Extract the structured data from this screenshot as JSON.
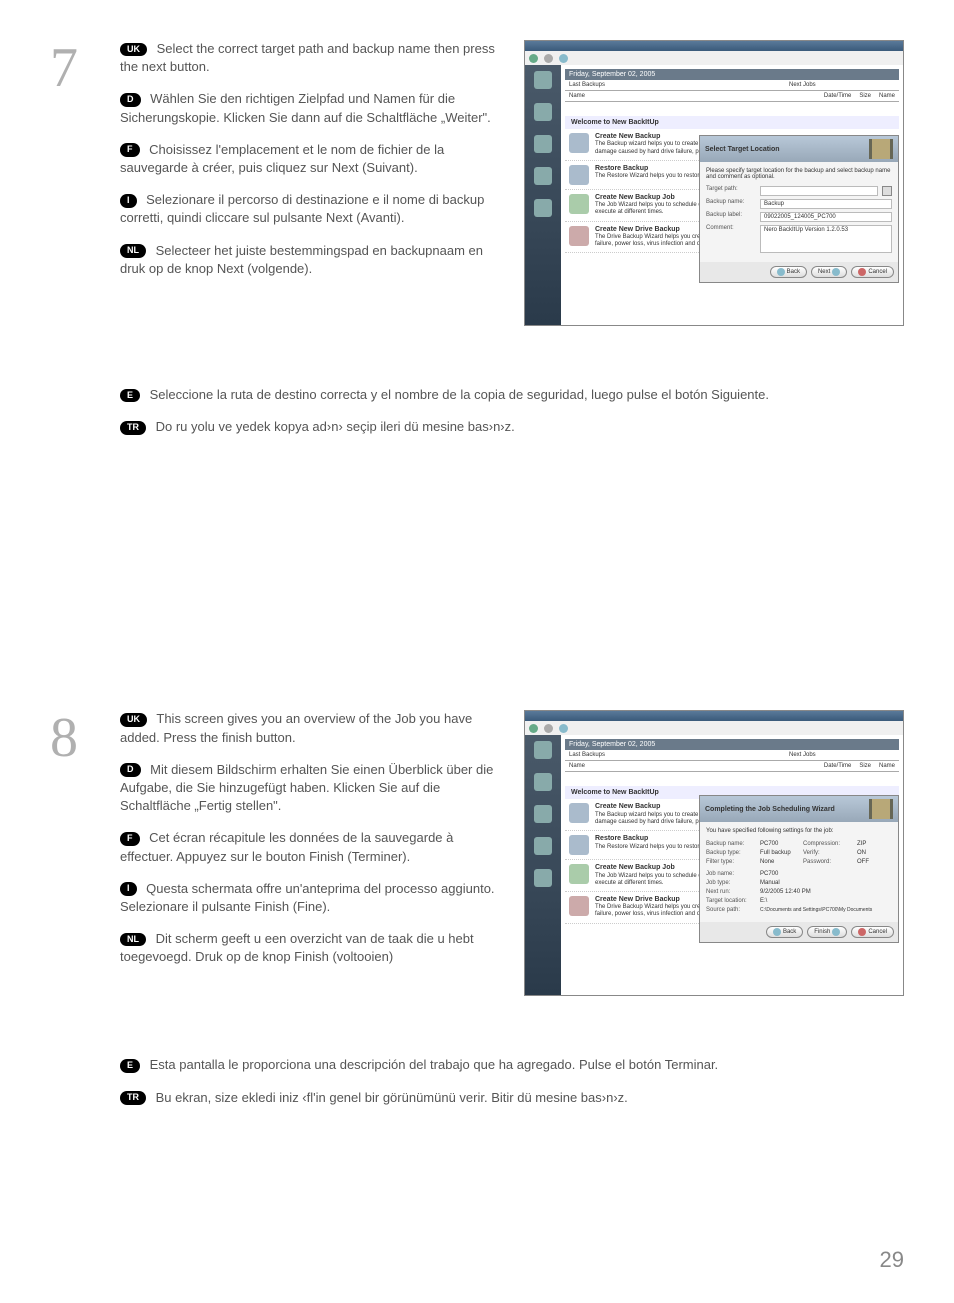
{
  "step7": {
    "number": "7",
    "uk": "Select the correct target path and backup name then press the next button.",
    "d": "Wählen Sie den richtigen Zielpfad und Namen für die Sicherungskopie. Klicken Sie dann auf die Schaltfläche „Weiter\".",
    "f": "Choisissez l'emplacement et le nom de fichier de la sauvegarde à créer, puis cliquez sur Next (Suivant).",
    "i": "Selezionare il percorso di destinazione e il nome di backup corretti, quindi cliccare sul pulsante Next (Avanti).",
    "nl": "Selecteer het juiste bestemmingspad en backupnaam en druk op de knop Next (volgende).",
    "e": "Seleccione la ruta de destino correcta y el nombre de la copia de seguridad, luego pulse el botón Siguiente.",
    "tr": "Do ru yolu ve yedek kopya ad›n› seçip ileri dü mesine bas›n›z."
  },
  "step8": {
    "number": "8",
    "uk": "This screen gives you an overview of the Job you have added. Press the finish button.",
    "d": "Mit diesem Bildschirm erhalten Sie einen Überblick über die Aufgabe, die Sie hinzugefügt haben. Klicken Sie auf die Schaltfläche „Fertig stellen\".",
    "f": "Cet écran récapitule les données de la sauvegarde à effectuer. Appuyez sur le bouton Finish (Terminer).",
    "i": "Questa schermata offre un'anteprima del processo aggiunto. Selezionare il pulsante Finish (Fine).",
    "nl": "Dit scherm geeft u een overzicht van de taak die u hebt toegevoegd. Druk op de knop Finish (voltooien)",
    "e": "Esta pantalla le proporciona una descripción del trabajo que ha agregado. Pulse el botón Terminar.",
    "tr": "Bu ekran, size ekledi iniz ‹fl'in genel bir görünümünü verir. Bitir dü mesine bas›n›z."
  },
  "badges": {
    "uk": "UK",
    "d": "D",
    "f": "F",
    "i": "I",
    "nl": "NL",
    "e": "E",
    "tr": "TR"
  },
  "screenshot7": {
    "date": "Friday, September 02, 2005",
    "lastBackups": "Last Backups",
    "nextJobs": "Next Jobs",
    "colName": "Name",
    "colDateTime": "Date/Time",
    "colSize": "Size",
    "welcome": "Welcome to New BackItUp",
    "item1_title": "Create New Backup",
    "item1_text": "The Backup wizard helps you to create a backup of your programs and files you can prevent data loss and damage caused by hard drive failure, power loss, virus infection and other potentially damaging causes.",
    "item2_title": "Restore Backup",
    "item2_text": "The Restore Wizard helps you to restore your previously BackItUp data in the amount after data loss or damage.",
    "item3_title": "Create New Backup Job",
    "item3_text": "The Job Wizard helps you to schedule different jobs for creating backups of your data then you can be notified to execute at different times.",
    "item4_title": "Create New Drive Backup",
    "item4_text": "The Drive Backup Wizard helps you create backups of your partitions and hard drive caused by hard drive failure, power loss, virus infection and other.",
    "dialog_title": "Select Target Location",
    "dialog_sub": "Please specify target location for the backup and select backup name and comment as optional.",
    "targetPath": "Target path:",
    "backupName": "Backup name:",
    "backupName_val": "Backup",
    "backupLabel": "Backup label:",
    "backupLabel_val": "09022005_124005_PC700",
    "comment": "Comment:",
    "comment_val": "Nero BackItUp Version 1.2.0.53",
    "btnBack": "Back",
    "btnNext": "Next",
    "btnCancel": "Cancel"
  },
  "screenshot8": {
    "date": "Friday, September 02, 2005",
    "dialog_title": "Completing the Job Scheduling Wizard",
    "dialog_sub": "You have specified following settings for the job:",
    "row1_l": "Backup name:",
    "row1_v": "PC700",
    "row2_l": "Backup type:",
    "row2_v": "Full backup",
    "row3_l": "Filter type:",
    "row3_v": "None",
    "row4_l": "Compression:",
    "row4_v": "ZIP",
    "row5_l": "Verify:",
    "row5_v": "ON",
    "row6_l": "Password:",
    "row6_v": "OFF",
    "row7_l": "Job name:",
    "row7_v": "PC700",
    "row8_l": "Job type:",
    "row8_v": "Manual",
    "row9_l": "Next run:",
    "row9_v": "9/2/2005 12:40 PM",
    "row10_l": "Target location:",
    "row10_v": "E:\\",
    "row11_l": "Source path:",
    "row11_v": "C:\\Documents and Settings\\PC700\\My Documents",
    "btnBack": "Back",
    "btnFinish": "Finish",
    "btnCancel": "Cancel"
  },
  "pageNumber": "29"
}
